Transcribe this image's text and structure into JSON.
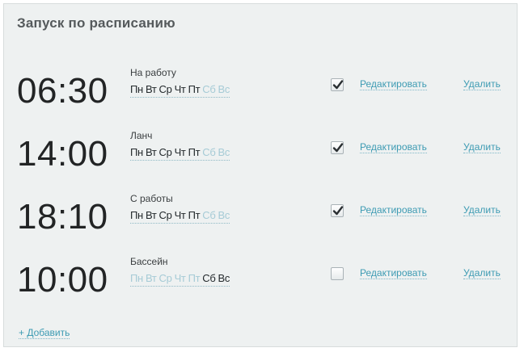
{
  "panel": {
    "title": "Запуск по расписанию",
    "add_label": "+ Добавить"
  },
  "schedules": [
    {
      "time": "06:30",
      "name": "На работу",
      "days": [
        {
          "label": "Пн",
          "active": true
        },
        {
          "label": "Вт",
          "active": true
        },
        {
          "label": "Ср",
          "active": true
        },
        {
          "label": "Чт",
          "active": true
        },
        {
          "label": "Пт",
          "active": true
        },
        {
          "label": "Сб",
          "active": false
        },
        {
          "label": "Вс",
          "active": false
        }
      ],
      "enabled": true,
      "edit_label": "Редактировать",
      "delete_label": "Удалить"
    },
    {
      "time": "14:00",
      "name": "Ланч",
      "days": [
        {
          "label": "Пн",
          "active": true
        },
        {
          "label": "Вт",
          "active": true
        },
        {
          "label": "Ср",
          "active": true
        },
        {
          "label": "Чт",
          "active": true
        },
        {
          "label": "Пт",
          "active": true
        },
        {
          "label": "Сб",
          "active": false
        },
        {
          "label": "Вс",
          "active": false
        }
      ],
      "enabled": true,
      "edit_label": "Редактировать",
      "delete_label": "Удалить"
    },
    {
      "time": "18:10",
      "name": "С работы",
      "days": [
        {
          "label": "Пн",
          "active": true
        },
        {
          "label": "Вт",
          "active": true
        },
        {
          "label": "Ср",
          "active": true
        },
        {
          "label": "Чт",
          "active": true
        },
        {
          "label": "Пт",
          "active": true
        },
        {
          "label": "Сб",
          "active": false
        },
        {
          "label": "Вс",
          "active": false
        }
      ],
      "enabled": true,
      "edit_label": "Редактировать",
      "delete_label": "Удалить"
    },
    {
      "time": "10:00",
      "name": "Бассейн",
      "days": [
        {
          "label": "Пн",
          "active": false
        },
        {
          "label": "Вт",
          "active": false
        },
        {
          "label": "Ср",
          "active": false
        },
        {
          "label": "Чт",
          "active": false
        },
        {
          "label": "Пт",
          "active": false
        },
        {
          "label": "Сб",
          "active": true
        },
        {
          "label": "Вс",
          "active": true
        }
      ],
      "enabled": false,
      "edit_label": "Редактировать",
      "delete_label": "Удалить"
    }
  ]
}
